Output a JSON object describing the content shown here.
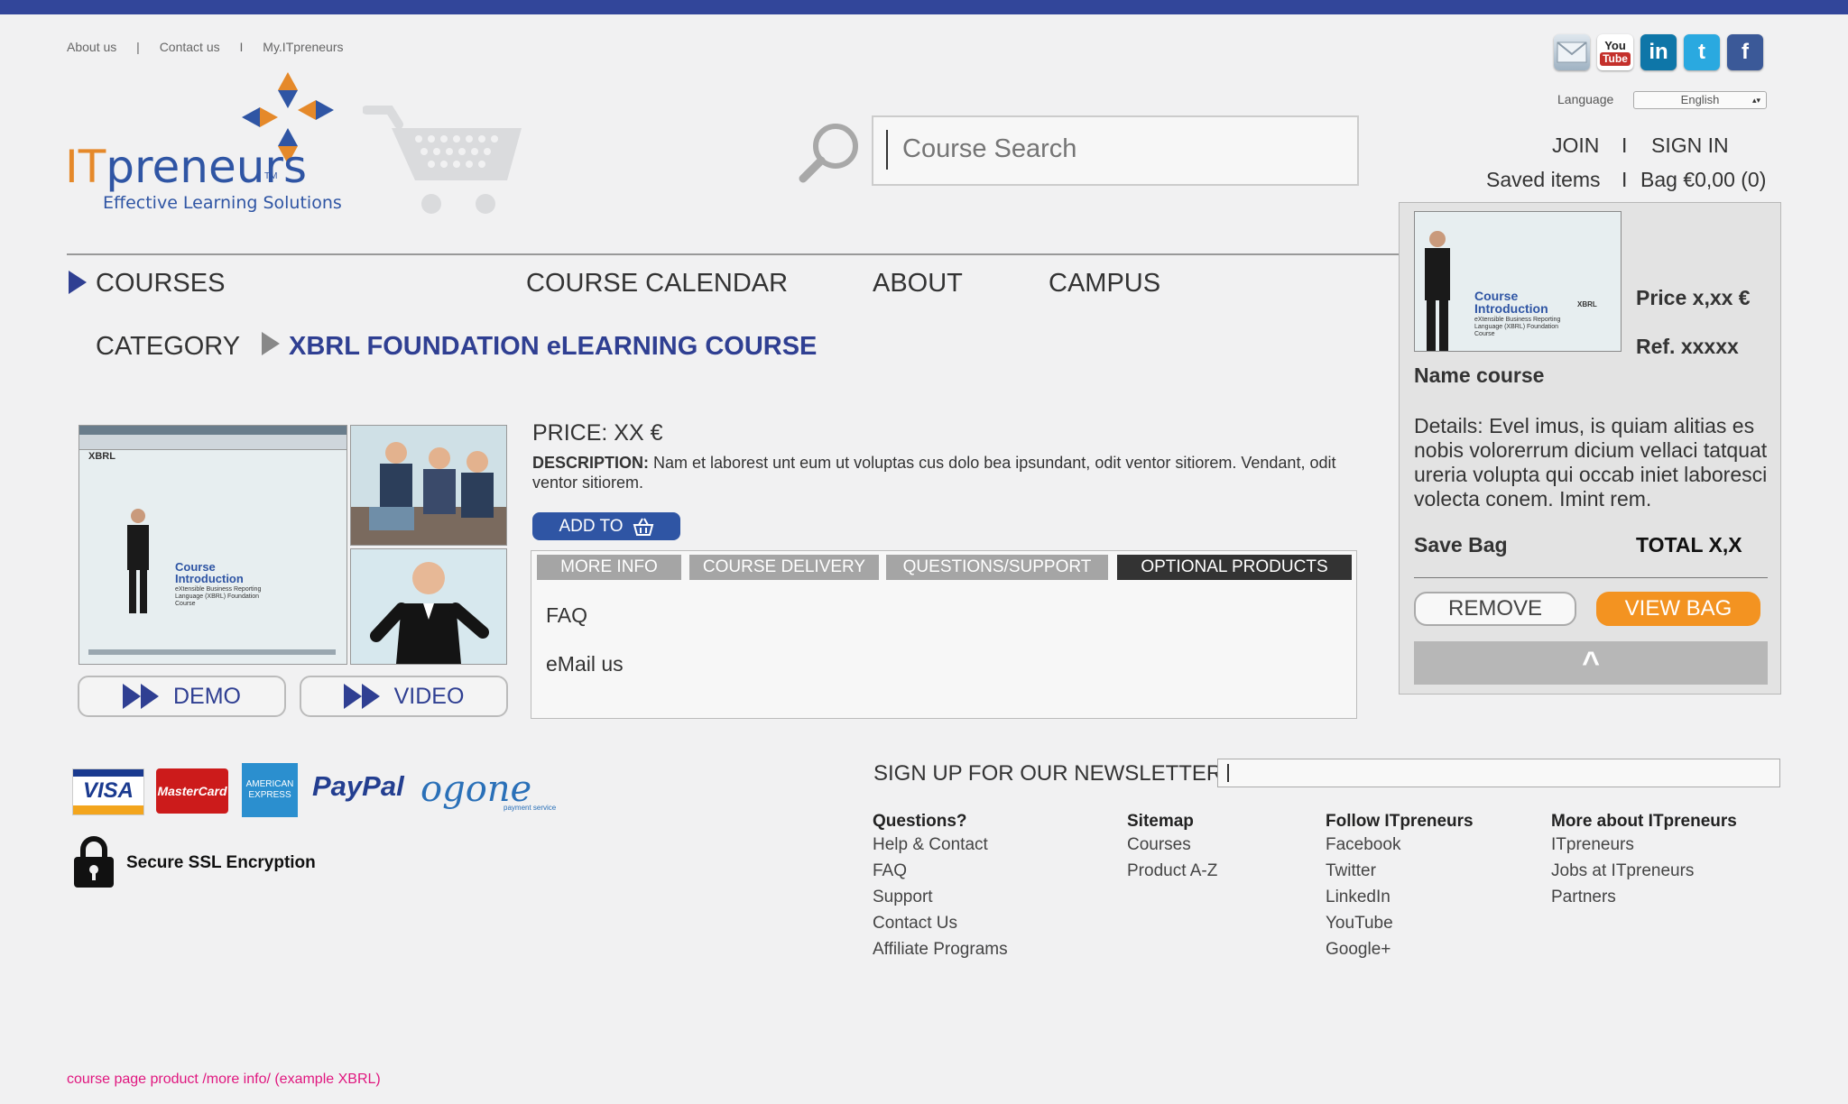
{
  "header": {
    "top_links": [
      "About us",
      "Contact us",
      "My.ITpreneurs"
    ],
    "separators": [
      "|",
      "I"
    ],
    "social": [
      {
        "name": "email-icon",
        "color": "#9fb2c2"
      },
      {
        "name": "youtube-icon",
        "color": "#c4302b",
        "label": "You Tube"
      },
      {
        "name": "linkedin-icon",
        "color": "#0e76a8",
        "label": "in"
      },
      {
        "name": "twitter-icon",
        "color": "#2aa9e0",
        "label": "t"
      },
      {
        "name": "facebook-icon",
        "color": "#3b5998",
        "label": "f"
      }
    ],
    "language_label": "Language",
    "language_value": "English",
    "logo_prefix": "IT",
    "logo_suffix": "preneurs",
    "logo_tm": "TM",
    "logo_tagline": "Effective Learning Solutions",
    "search_placeholder": "Course Search",
    "join": "JOIN",
    "sign_in": "SIGN IN",
    "account_sep": "I",
    "saved_items": "Saved items",
    "bag": "Bag €0,00 (0)"
  },
  "nav": {
    "items": [
      "COURSES",
      "COURSE CALENDAR",
      "ABOUT",
      "CAMPUS"
    ]
  },
  "breadcrumb": {
    "category": "CATEGORY",
    "title": "XBRL FOUNDATION eLEARNING COURSE"
  },
  "media": {
    "thumb_title_1": "Course",
    "thumb_title_2": "Introduction",
    "thumb_brand": "XBRL",
    "thumb_sub": "eXtensible Business Reporting Language (XBRL) Foundation Course",
    "demo_label": "DEMO",
    "video_label": "VIDEO"
  },
  "product": {
    "price": "PRICE: XX €",
    "desc_label": "DESCRIPTION:",
    "desc_text": " Nam et laborest unt eum ut voluptas cus dolo bea ipsundant, odit ventor sitiorem. Vendant, odit ventor sitiorem.",
    "add_to": "ADD  TO",
    "tabs": [
      "MORE INFO",
      "COURSE DELIVERY",
      "QUESTIONS/SUPPORT",
      "OPTIONAL PRODUCTS"
    ],
    "links": [
      "FAQ",
      "eMail us"
    ]
  },
  "bag_panel": {
    "price": "Price x,xx €",
    "ref": "Ref. xxxxx",
    "name": "Name course",
    "details": "Details: Evel imus, is quiam alitias es nobis volorerrum dicium vellaci tatquat ureria volupta qui occab iniet laboresci volecta conem. Imint rem.",
    "save_bag": "Save Bag",
    "total": "TOTAL X,X",
    "remove": "REMOVE",
    "view_bag": "VIEW BAG",
    "collapse": "^"
  },
  "footer": {
    "payments": [
      "VISA",
      "MasterCard",
      "AMERICAN EXPRESS",
      "PayPal",
      "ogone",
      "payment service"
    ],
    "ssl": "Secure SSL Encryption",
    "newsletter": "SIGN UP FOR OUR NEWSLETTER",
    "columns": [
      {
        "head": "Questions?",
        "links": [
          "Help & Contact",
          "FAQ",
          "Support",
          "Contact Us",
          "Affiliate Programs"
        ]
      },
      {
        "head": "Sitemap",
        "links": [
          "Courses",
          "Product A-Z"
        ]
      },
      {
        "head": "Follow ITpreneurs",
        "links": [
          "Facebook",
          "Twitter",
          "LinkedIn",
          "YouTube",
          "Google+"
        ]
      },
      {
        "head": "More about ITpreneurs",
        "links": [
          "ITpreneurs",
          "Jobs at ITpreneurs",
          "Partners"
        ]
      }
    ],
    "note": "course page product /more info/ (example XBRL)"
  },
  "colors": {
    "brand_blue": "#2f3f92",
    "orange": "#f39321",
    "topbar": "#32469a"
  }
}
